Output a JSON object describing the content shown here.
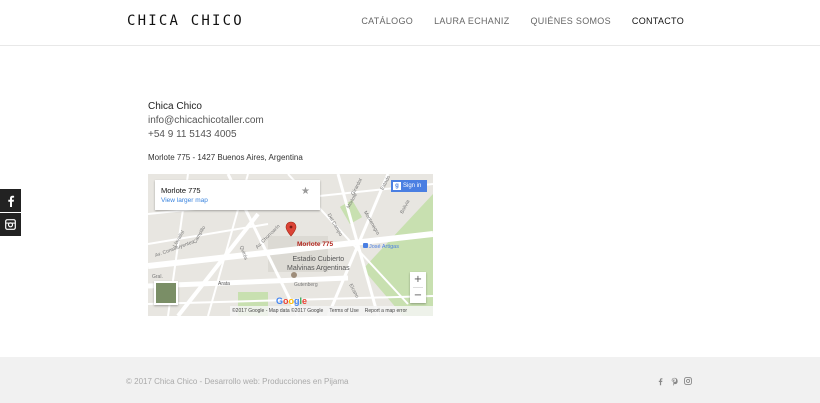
{
  "header": {
    "logo": "CHICA CHICO",
    "nav": [
      {
        "label": "CATÁLOGO"
      },
      {
        "label": "LAURA ECHANIZ"
      },
      {
        "label": "QUIÉNES SOMOS"
      },
      {
        "label": "CONTACTO"
      }
    ]
  },
  "side_social": [
    {
      "icon": "facebook-icon"
    },
    {
      "icon": "instagram-icon"
    }
  ],
  "contact": {
    "name": "Chica Chico",
    "email": "info@chicachicotaller.com",
    "phone": "+54 9 11 5143 4005",
    "address": "Morlote 775 - 1427 Buenos Aires, Argentina"
  },
  "map": {
    "card_title": "Morlote 775",
    "card_link": "View larger map",
    "signin": "Sign in",
    "pin_label": "Morlote 775",
    "poi_stadium_line1": "Estadio Cubierto",
    "poi_stadium_line2": "Malvinas Argentinas",
    "poi_station": "José Artigas",
    "zoom_in": "+",
    "zoom_out": "−",
    "google": "Google",
    "footer_items": [
      "©2017 Google - Map data ©2017 Google",
      "Terms of Use",
      "Report a map error"
    ],
    "streets": [
      "Estado",
      "Morlote",
      "Montenegro",
      "Del Campo",
      "Av. Chorroarín",
      "Quirós",
      "Llavallol",
      "Campillo",
      "Gutenberg",
      "Arata",
      "Elcano",
      "Av. Constituyentes",
      "Bolivia",
      "Girardot",
      "Gral."
    ]
  },
  "footer": {
    "copyright": "© 2017 Chica Chico - Desarrollo web: Producciones en Pijama",
    "social": [
      {
        "icon": "facebook-icon"
      },
      {
        "icon": "pinterest-icon"
      },
      {
        "icon": "instagram-icon"
      }
    ]
  },
  "colors": {
    "accent_dark": "#222222",
    "footer_bg": "#f1f1f1",
    "map_link": "#3a84df",
    "pin": "#db4437"
  }
}
